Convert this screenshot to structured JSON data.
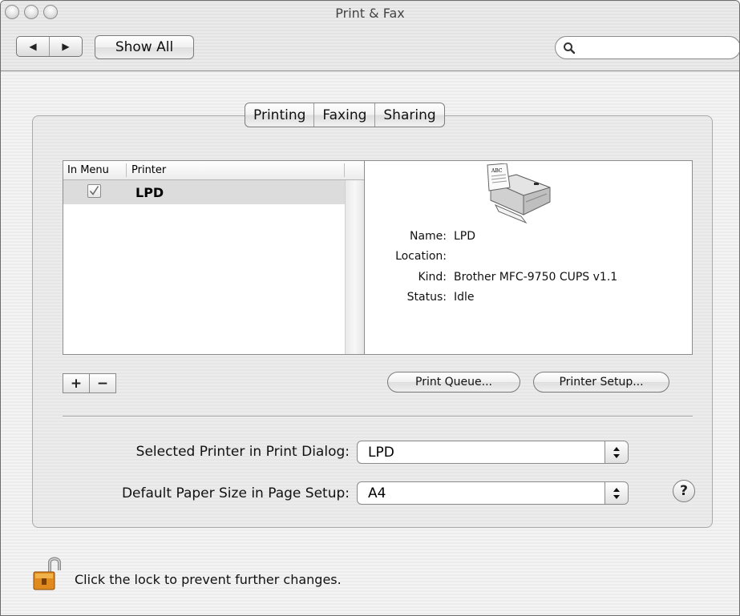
{
  "window": {
    "title": "Print & Fax"
  },
  "toolbar": {
    "back_glyph": "◀",
    "forward_glyph": "▶",
    "show_all_label": "Show All",
    "search_value": ""
  },
  "tabs": [
    {
      "label": "Printing",
      "selected": true
    },
    {
      "label": "Faxing",
      "selected": false
    },
    {
      "label": "Sharing",
      "selected": false
    }
  ],
  "printer_list": {
    "columns": [
      "In Menu",
      "Printer"
    ],
    "rows": [
      {
        "in_menu": true,
        "printer": "LPD",
        "selected": true
      }
    ]
  },
  "printer_info": {
    "icon": "printer-icon",
    "fields": [
      {
        "label": "Name:",
        "value": "LPD"
      },
      {
        "label": "Location:",
        "value": ""
      },
      {
        "label": "Kind:",
        "value": "Brother MFC-9750 CUPS v1.1"
      },
      {
        "label": "Status:",
        "value": "Idle"
      }
    ]
  },
  "list_buttons": {
    "add": "+",
    "remove": "−"
  },
  "actions": {
    "print_queue": "Print Queue...",
    "printer_setup": "Printer Setup..."
  },
  "settings": {
    "selected_printer_label": "Selected Printer in Print Dialog:",
    "selected_printer_value": "LPD",
    "paper_size_label": "Default Paper Size in Page Setup:",
    "paper_size_value": "A4"
  },
  "help": {
    "glyph": "?"
  },
  "lock": {
    "text": "Click the lock to prevent further changes.",
    "state": "unlocked"
  }
}
